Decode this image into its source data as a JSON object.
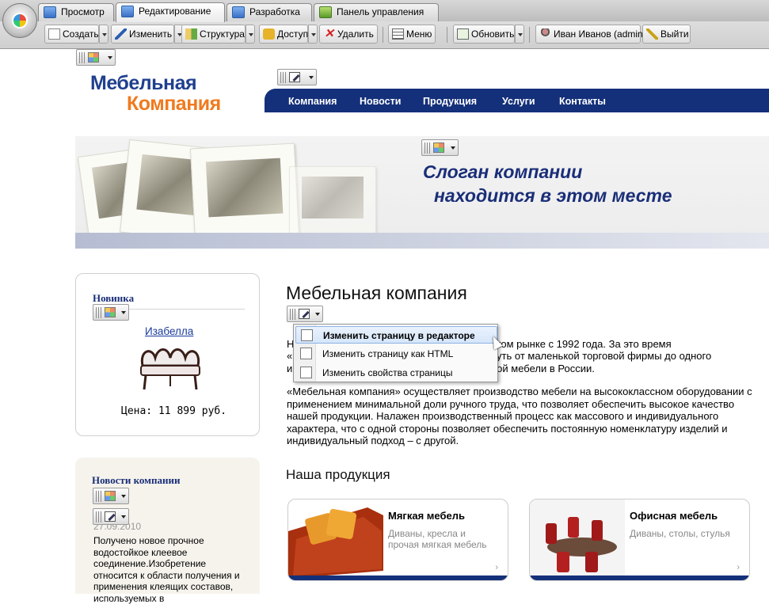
{
  "admin": {
    "tabs": [
      {
        "label": "Просмотр"
      },
      {
        "label": "Редактирование"
      },
      {
        "label": "Разработка"
      },
      {
        "label": "Панель управления"
      }
    ],
    "toolbar": {
      "create": "Создать",
      "edit": "Изменить",
      "structure": "Структура",
      "access": "Доступ",
      "delete": "Удалить",
      "menu": "Меню",
      "refresh": "Обновить",
      "user": "Иван Иванов (admin)",
      "logout": "Выйти"
    }
  },
  "site": {
    "logo_line1": "Мебельная",
    "logo_line2": "Компания",
    "nav": [
      "Компания",
      "Новости",
      "Продукция",
      "Услуги",
      "Контакты"
    ],
    "slogan_line1": "Слоган компании",
    "slogan_line2": "находится в этом месте"
  },
  "sidebar": {
    "new_title": "Новинка",
    "new_link": "Изабелла",
    "new_price": "Цена: 11 899 руб.",
    "news_title": "Новости компании",
    "news_date": "27.09.2010",
    "news_text": "Получено новое прочное водостойкое клеевое соединение.Изобретение относится к области получения и применения клеящих составов, используемых в"
  },
  "main": {
    "title": "Мебельная компания",
    "p1_left": [
      "Н",
      "«",
      "и"
    ],
    "p1_right": [
      "ском рынке с 1992 года. За это время",
      "путь от маленькой торговой фирмы до одного",
      "ной мебели в России."
    ],
    "p2": "«Мебельная компания» осуществляет производство мебели на высококлассном оборудовании с применением минимальной доли ручного труда, что позволяет обеспечить высокое качество нашей продукции. Налажен производственный процесс как массового и индивидуального характера, что с одной стороны позволяет обеспечить постоянную номенклатуру изделий и индивидуальный подход – с другой.",
    "products_title": "Наша продукция",
    "products": [
      {
        "title": "Мягкая мебель",
        "desc": "Диваны, кресла и прочая мягкая мебель"
      },
      {
        "title": "Офисная мебель",
        "desc": "Диваны, столы, стулья"
      }
    ]
  },
  "context_menu": {
    "items": [
      "Изменить страницу в редакторе",
      "Изменить страницу как HTML",
      "Изменить свойства страницы"
    ]
  }
}
